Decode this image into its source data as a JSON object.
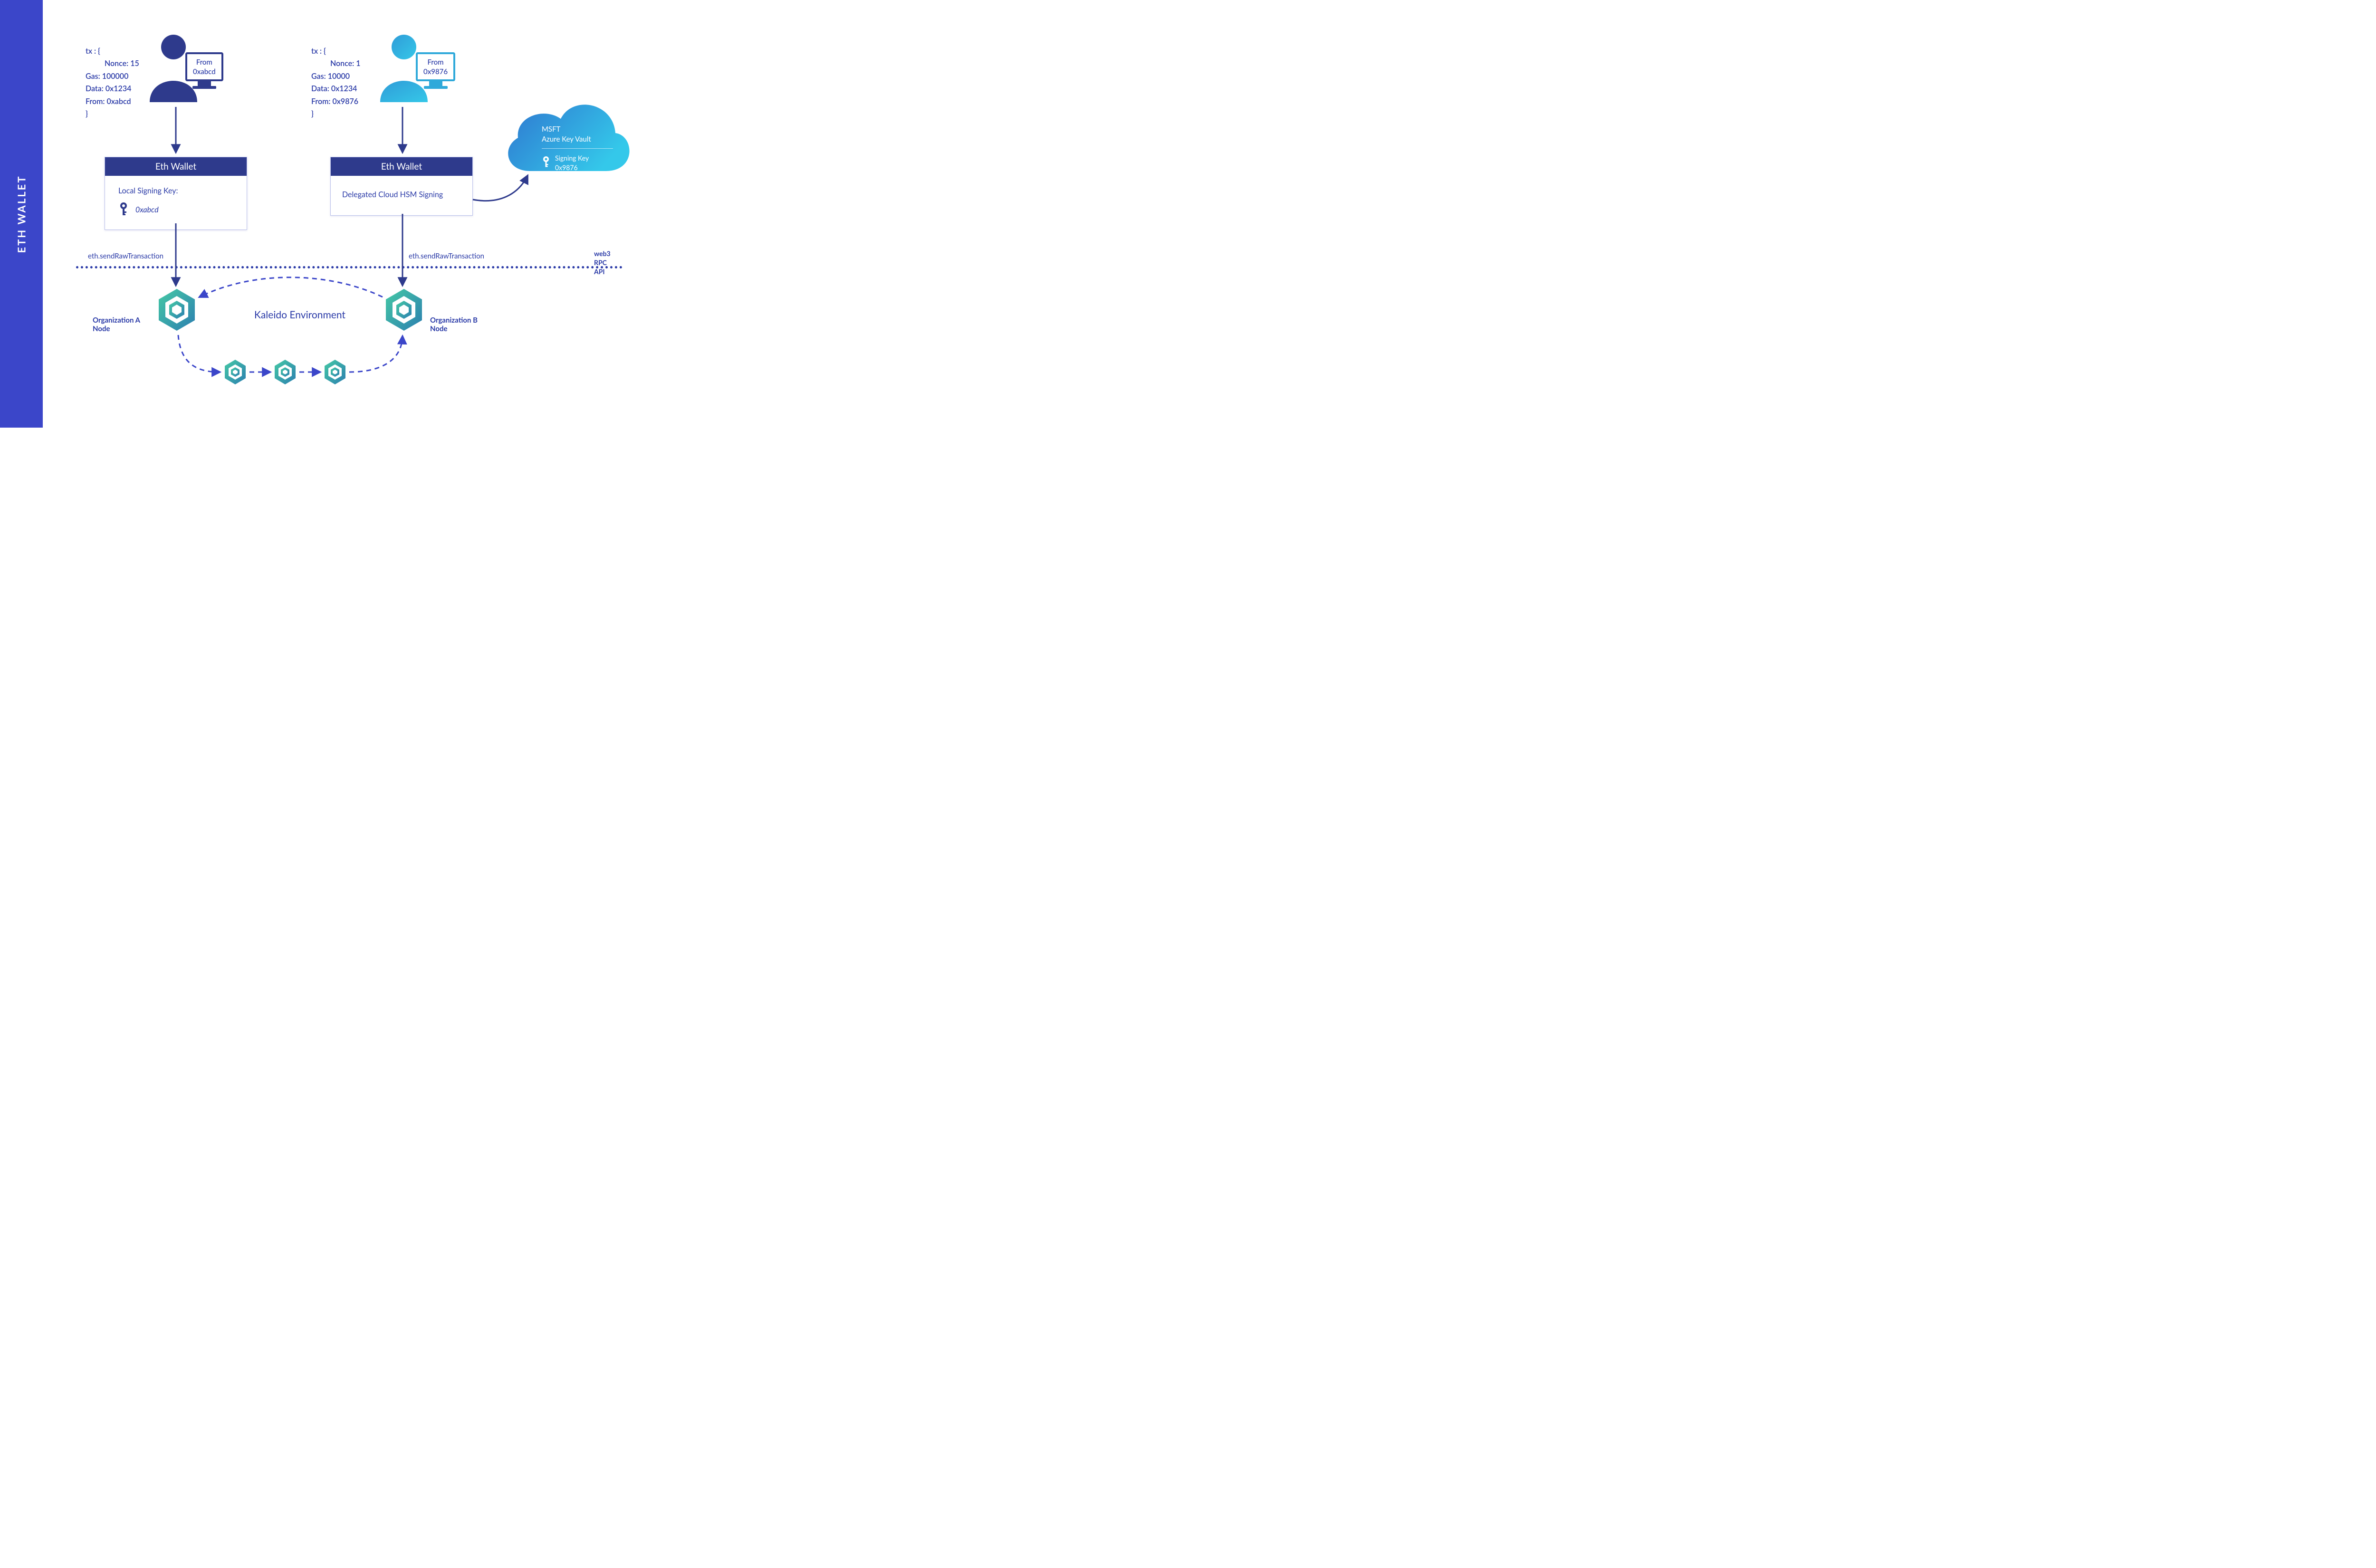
{
  "sidebar": {
    "title": "ETH  WALLET"
  },
  "txA": {
    "open": "tx : {",
    "nonce": "Nonce: 15",
    "gas": "Gas: 100000",
    "data": "Data: 0x1234",
    "from": "From: 0xabcd",
    "close": "}"
  },
  "txB": {
    "open": "tx : {",
    "nonce": "Nonce: 1",
    "gas": "Gas: 10000",
    "data": "Data: 0x1234",
    "from": "From: 0x9876",
    "close": "}"
  },
  "screenA": {
    "line1": "From",
    "line2": "0xabcd"
  },
  "screenB": {
    "line1": "From",
    "line2": "0x9876"
  },
  "walletA": {
    "title": "Eth Wallet",
    "body": "Local Signing Key:",
    "keyval": "0xabcd"
  },
  "walletB": {
    "title": "Eth Wallet",
    "body": "Delegated Cloud HSM Signing"
  },
  "sendA": "eth.sendRawTransaction",
  "sendB": "eth.sendRawTransaction",
  "api": {
    "l1": "web3",
    "l2": "RPC",
    "l3": "API"
  },
  "orgA": {
    "l1": "Organization A",
    "l2": "Node"
  },
  "orgB": {
    "l1": "Organization B",
    "l2": "Node"
  },
  "env": "Kaleido Environment",
  "cloud": {
    "t1": "MSFT",
    "t2": "Azure Key Vault",
    "key_label": "Signing Key",
    "key_val": "0x9876"
  },
  "colors": {
    "primary": "#2a3aa7",
    "darkblue": "#2e3a8c",
    "side": "#3b46c9",
    "cyan": "#2fb8d6",
    "cyan2": "#36c3ea",
    "green1": "#3fb899",
    "green2": "#2c7fb0"
  }
}
